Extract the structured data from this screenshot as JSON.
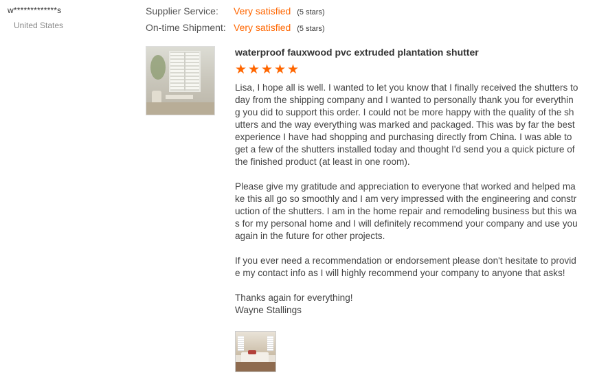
{
  "reviewer": {
    "name": "w*************s",
    "country": "United States"
  },
  "ratings": [
    {
      "label": "Supplier Service:",
      "value": "Very satisfied",
      "stars_text": "(5 stars)"
    },
    {
      "label": "On-time Shipment:",
      "value": "Very satisfied",
      "stars_text": "(5 stars)"
    }
  ],
  "review": {
    "product_title": "waterproof fauxwood pvc extruded plantation shutter",
    "star_rating": 5,
    "paragraphs": [
      "Lisa, I hope all is well.  I wanted to let you know that I finally received the shutters today from the shipping company and I wanted to personally thank you for everything you did to support this order.  I could not be more happy with the quality of the shutters and the way everything was marked and packaged.  This was by far the best experience I have had shopping and purchasing directly from China.  I was able to get a few of the shutters installed today and thought I'd send you a quick picture of the finished product (at least in one room).",
      "Please give my gratitude and appreciation to everyone that worked and helped make this all go so smoothly and I am very impressed with the engineering and construction of the shutters.  I am in the home repair and remodeling business but this was for my personal home and I will definitely recommend your company and use you again in the future for other projects.",
      "If you ever need a recommendation or endorsement please don't hesitate to provide my contact info as I will highly recommend your company to anyone that asks!",
      "Thanks again for everything!",
      "Wayne Stallings"
    ]
  },
  "colors": {
    "accent": "#ff6600",
    "text": "#444444",
    "muted": "#888888"
  }
}
